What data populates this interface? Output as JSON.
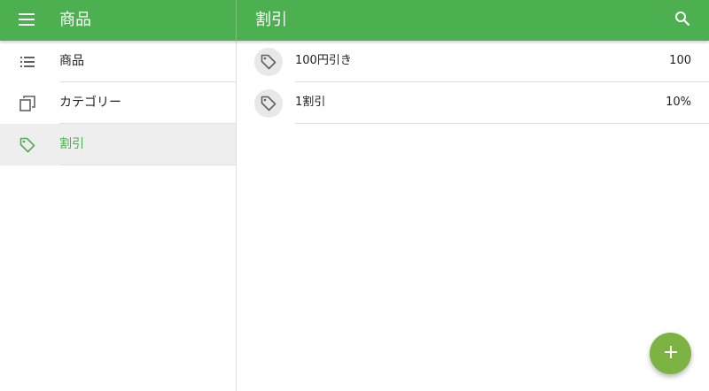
{
  "appbar": {
    "left_title": "商品",
    "right_title": "割引",
    "menu_icon": "menu-icon",
    "search_icon": "search-icon",
    "color": "#4caf50"
  },
  "sidebar": {
    "items": [
      {
        "label": "商品",
        "icon": "list-icon",
        "active": false
      },
      {
        "label": "カテゴリー",
        "icon": "copy-icon",
        "active": false
      },
      {
        "label": "割引",
        "icon": "tag-icon",
        "active": true
      }
    ]
  },
  "discounts": [
    {
      "name": "100円引き",
      "value": "100",
      "icon": "tag-icon"
    },
    {
      "name": "1割引",
      "value": "10%",
      "icon": "tag-icon"
    }
  ],
  "fab": {
    "icon": "plus-icon",
    "color": "#7cb342"
  }
}
